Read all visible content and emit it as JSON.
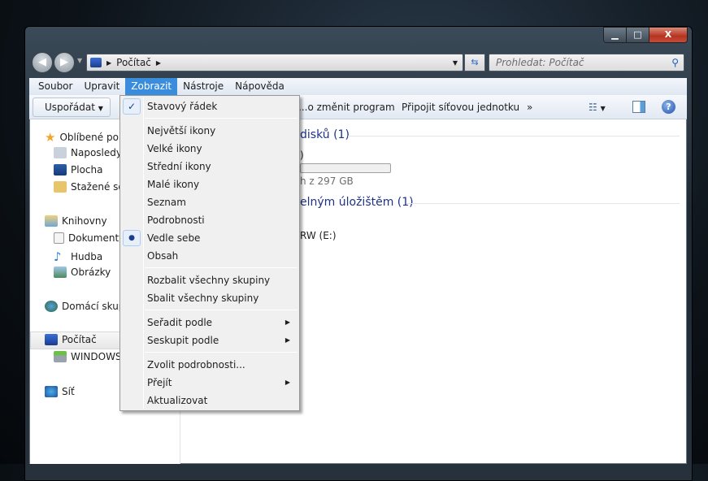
{
  "window": {
    "caption_buttons": {
      "minimize": "▁",
      "maximize": "□",
      "close": "X"
    }
  },
  "address": {
    "breadcrumb": [
      "Počítač"
    ],
    "search_placeholder": "Prohledat: Počítač"
  },
  "menubar": [
    "Soubor",
    "Upravit",
    "Zobrazit",
    "Nástroje",
    "Nápověda"
  ],
  "toolbar": {
    "organize": "Uspořádat",
    "uninstall": "...o změnit program",
    "map_drive": "Připojit síťovou jednotku",
    "more": "»"
  },
  "nav": {
    "favorites": "Oblíbené pol...",
    "recent": "Naposledy",
    "desktop": "Plocha",
    "downloads": "Stažené sou...",
    "libraries": "Knihovny",
    "documents": "Dokumenty",
    "music": "Hudba",
    "pictures": "Obrázky",
    "homegroup": "Domácí skup...",
    "computer": "Počítač",
    "windows": "WINDOWS",
    "network": "Síť"
  },
  "content": {
    "hdd_group": "disků (1)",
    "drive_partial": ")",
    "drive_space": "h z 297 GB",
    "removable_group": "elným úložištěm (1)",
    "dvd": "RW (E:)"
  },
  "view_menu": {
    "items": [
      {
        "label": "Stavový řádek",
        "mark": "check"
      },
      {
        "label": "Největší ikony"
      },
      {
        "label": "Velké ikony"
      },
      {
        "label": "Střední ikony"
      },
      {
        "label": "Malé ikony"
      },
      {
        "label": "Seznam"
      },
      {
        "label": "Podrobnosti"
      },
      {
        "label": "Vedle sebe",
        "mark": "radio"
      },
      {
        "label": "Obsah"
      },
      {
        "label": "Rozbalit všechny skupiny"
      },
      {
        "label": "Sbalit všechny skupiny"
      },
      {
        "label": "Seřadit podle",
        "submenu": true
      },
      {
        "label": "Seskupit podle",
        "submenu": true
      },
      {
        "label": "Zvolit podrobnosti..."
      },
      {
        "label": "Přejít",
        "submenu": true
      },
      {
        "label": "Aktualizovat"
      }
    ]
  }
}
